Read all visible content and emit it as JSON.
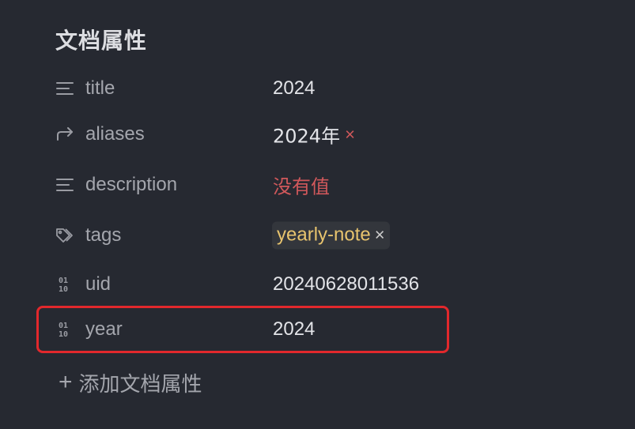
{
  "section": {
    "title": "文档属性"
  },
  "properties": [
    {
      "icon": "text-lines-icon",
      "name": "title",
      "value": "2024"
    },
    {
      "icon": "arrow-redirect-icon",
      "name": "aliases",
      "value": "2024年",
      "remove_glyph": "×"
    },
    {
      "icon": "text-lines-icon",
      "name": "description",
      "value": "没有值"
    },
    {
      "icon": "tag-icon",
      "name": "tags",
      "value": "yearly-note",
      "remove_glyph": "×"
    },
    {
      "icon": "binary-number-icon",
      "name": "uid",
      "value": "20240628011536"
    },
    {
      "icon": "binary-number-icon",
      "name": "year",
      "value": "2024"
    }
  ],
  "add_property": {
    "icon": "+",
    "label": "添加文档属性"
  },
  "colors": {
    "background": "#262931",
    "empty_value": "#d0585b",
    "tag_text": "#e8c46e",
    "highlight": "#e2282c"
  }
}
